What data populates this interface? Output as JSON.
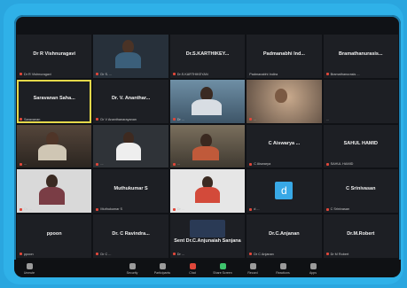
{
  "tiles": [
    {
      "name": "Dr R Vishnuragavi",
      "sub": "Dr R Vishnuragavi"
    },
    {
      "name": "",
      "sub": "Dr S. ..."
    },
    {
      "name": "Dr.S.KARTHIKEY...",
      "sub": "Dr.S.KARTHIKEYAN"
    },
    {
      "name": "Padmanabhi Ind...",
      "sub": "Padmanabhi Indira"
    },
    {
      "name": "Bramathanurasis...",
      "sub": "Bramathanurasis ..."
    },
    {
      "name": "Saravanan Saha...",
      "sub": "Saravanan"
    },
    {
      "name": "Dr. V. Ananthar...",
      "sub": "Dr V Ananthanarayanan"
    },
    {
      "name": "",
      "sub": "Dr ..."
    },
    {
      "name": "",
      "sub": "..."
    },
    {
      "name": "",
      "sub": "..."
    },
    {
      "name": "",
      "sub": "..."
    },
    {
      "name": "",
      "sub": "..."
    },
    {
      "name": "",
      "sub": "..."
    },
    {
      "name": "C Aiswarya ...",
      "sub": "C Aiswarya"
    },
    {
      "name": "SAHUL HAMID",
      "sub": "SAHUL HAMID"
    },
    {
      "name": "",
      "sub": "Dr. ..."
    },
    {
      "name": "Muthukumar S",
      "sub": "Muthukumar S"
    },
    {
      "name": "",
      "sub": "Dr ..."
    },
    {
      "name": "",
      "sub": "d ..."
    },
    {
      "name": "C Srinivasan",
      "sub": "C Srinivasan"
    },
    {
      "name": "ppoon",
      "sub": "ppoon"
    },
    {
      "name": "Dr. C Ravindra...",
      "sub": "Dr C ..."
    },
    {
      "name": "Sent Dr.C.Anjunaiah Sanjana",
      "sub": "Dr ..."
    },
    {
      "name": "Dr.C.Anjanan",
      "sub": "Dr C Anjanan"
    },
    {
      "name": "Dr.M.Robert",
      "sub": "Dr M Robert"
    }
  ],
  "avatar_letter": "d",
  "toolbar": [
    {
      "label": "Unmute"
    },
    {
      "label": "Security"
    },
    {
      "label": "Participants"
    },
    {
      "label": "Chat"
    },
    {
      "label": "Share Screen"
    },
    {
      "label": "Record"
    },
    {
      "label": "Reactions"
    },
    {
      "label": "Apps"
    }
  ]
}
